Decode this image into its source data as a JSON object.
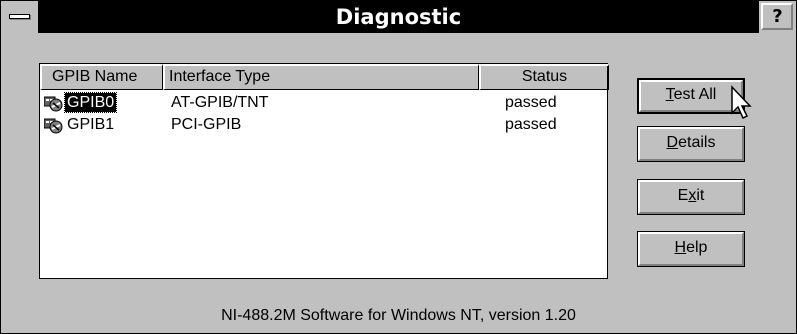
{
  "window": {
    "title": "Diagnostic",
    "help_label": "?"
  },
  "list": {
    "columns": [
      "GPIB Name",
      "Interface Type",
      "Status"
    ],
    "rows": [
      {
        "name": "GPIB0",
        "interface": "AT-GPIB/TNT",
        "status": "passed",
        "selected": true
      },
      {
        "name": "GPIB1",
        "interface": "PCI-GPIB",
        "status": "passed",
        "selected": false
      }
    ]
  },
  "buttons": {
    "test_all": {
      "mnemonic": "T",
      "rest": "est All"
    },
    "details": {
      "mnemonic": "D",
      "rest": "etails"
    },
    "exit": {
      "pre": "E",
      "mnemonic": "x",
      "rest": "it"
    },
    "help": {
      "mnemonic": "H",
      "rest": "elp"
    }
  },
  "footer": "NI-488.2M Software for Windows NT, version 1.20",
  "icons": [
    "system-menu-icon",
    "help-icon",
    "gpib-board-icon",
    "mouse-pointer-icon"
  ],
  "colors": {
    "face": "#c0c0c0",
    "titlebar": "#000000",
    "selection": "#000000"
  }
}
